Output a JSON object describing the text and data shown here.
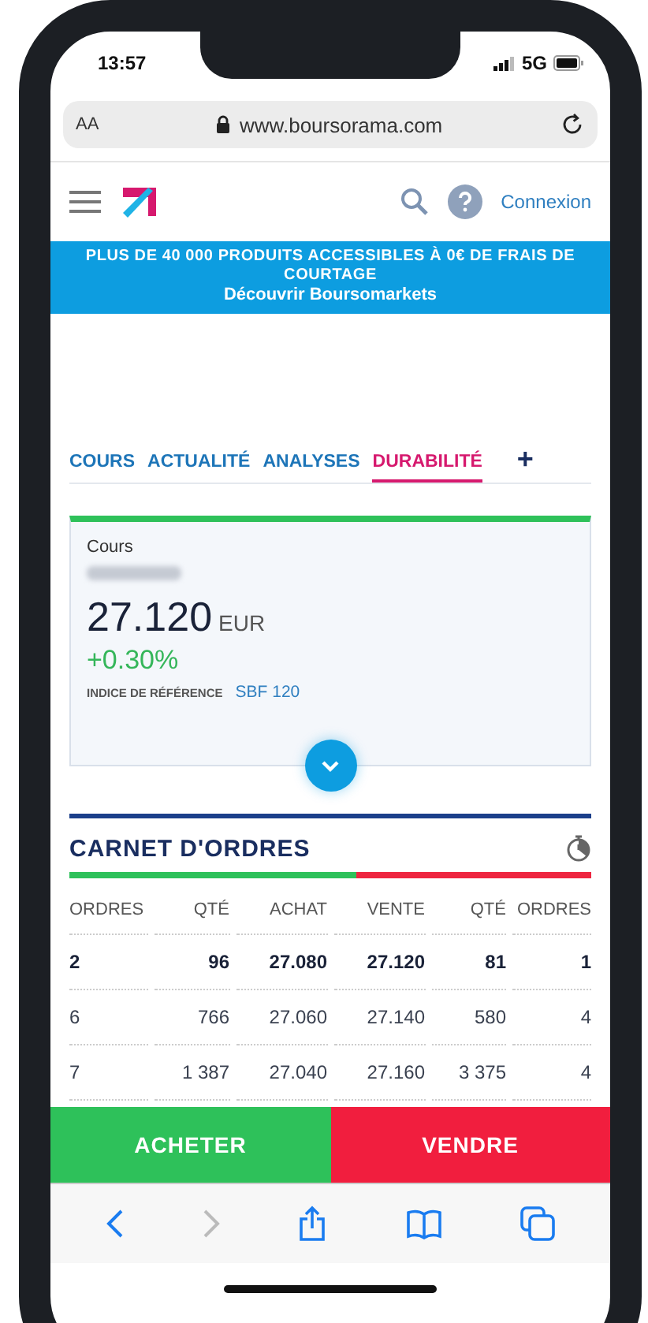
{
  "status_bar": {
    "time": "13:57",
    "network": "5G"
  },
  "browser": {
    "text_size": "AA",
    "url": "www.boursorama.com"
  },
  "header": {
    "login": "Connexion"
  },
  "banner": {
    "text": "PLUS DE 40 000 PRODUITS ACCESSIBLES À 0€ DE FRAIS DE COURTAGE",
    "link": "Découvrir Boursomarkets"
  },
  "tabs": [
    {
      "label": "COURS",
      "selected": false
    },
    {
      "label": "ACTUALITÉ",
      "selected": false
    },
    {
      "label": "ANALYSES",
      "selected": false
    },
    {
      "label": "DURABILITÉ",
      "selected": true
    }
  ],
  "more_tab": "+",
  "quote": {
    "label": "Cours",
    "price": "27.120",
    "currency": "EUR",
    "change": "+0.30%",
    "index_label": "INDICE DE RÉFÉRENCE",
    "index_value": "SBF 120"
  },
  "order_book": {
    "title": "CARNET D'ORDRES",
    "depth_bar": {
      "level": 0.55
    },
    "columns": [
      "ORDRES",
      "QTÉ",
      "ACHAT",
      "VENTE",
      "QTÉ",
      "ORDRES"
    ],
    "rows": [
      {
        "kind": "best",
        "cells": [
          "2",
          "96",
          "27.080",
          "27.120",
          "81",
          "1"
        ]
      },
      {
        "kind": "normal",
        "cells": [
          "6",
          "766",
          "27.060",
          "27.140",
          "580",
          "4"
        ]
      },
      {
        "kind": "normal",
        "cells": [
          "7",
          "1 387",
          "27.040",
          "27.160",
          "3 375",
          "4"
        ]
      }
    ]
  },
  "actions": [
    {
      "kind": "buy",
      "label": "ACHETER"
    },
    {
      "kind": "sell",
      "label": "VENDRE"
    }
  ]
}
